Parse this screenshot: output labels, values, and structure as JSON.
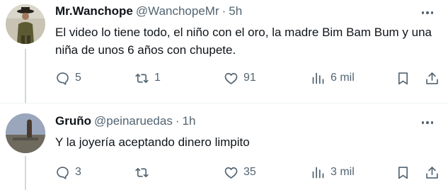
{
  "tweets": [
    {
      "author_name": "Mr.Wanchope",
      "handle": "@WanchopeMr",
      "separator": "·",
      "time": "5h",
      "text": "El video lo tiene todo, el niño con el oro, la madre Bim Bam Bum y una niña de unos 6 años con chupete.",
      "replies": "5",
      "retweets": "1",
      "likes": "91",
      "views": "6 mil"
    },
    {
      "author_name": "Gruño",
      "handle": "@peinaruedas",
      "separator": "·",
      "time": "1h",
      "text": "Y la joyería aceptando dinero limpito",
      "replies": "3",
      "retweets": "",
      "likes": "35",
      "views": "3 mil"
    }
  ],
  "icons": {
    "reply": "speech-bubble-icon",
    "retweet": "retweet-icon",
    "like": "heart-icon",
    "views": "bar-chart-icon",
    "bookmark": "bookmark-icon",
    "share": "share-upload-icon",
    "more": "more-horizontal-icon"
  },
  "colors": {
    "text": "#0f1419",
    "secondary": "#536471",
    "thread_line": "#cfd9de",
    "divider": "#eff3f4"
  }
}
